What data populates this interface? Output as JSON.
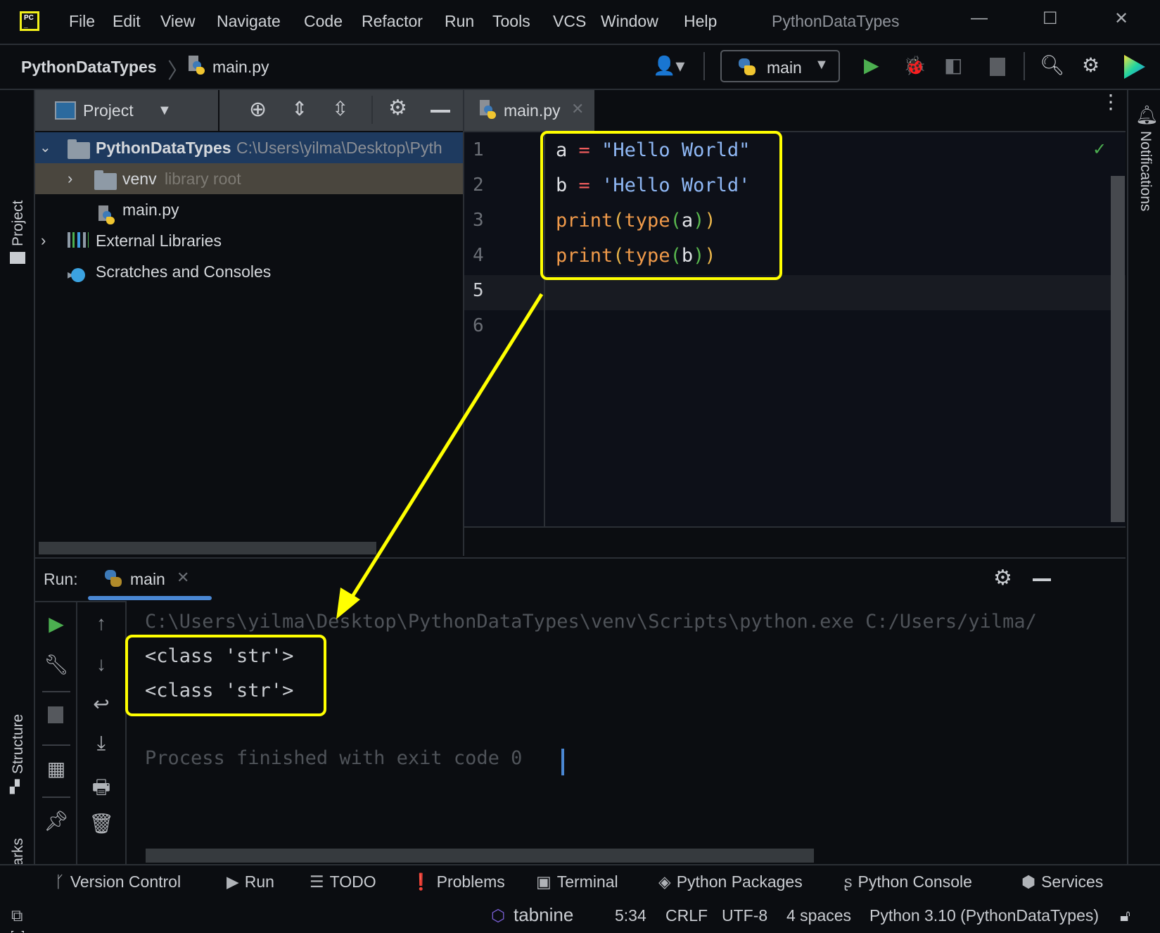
{
  "titlebar": {
    "menu": [
      "File",
      "Edit",
      "View",
      "Navigate",
      "Code",
      "Refactor",
      "Run",
      "Tools",
      "VCS",
      "Window",
      "Help"
    ],
    "window_title": "PythonDataTypes",
    "minimize": "—",
    "maximize": "☐",
    "close": "✕"
  },
  "navbar": {
    "project": "PythonDataTypes",
    "separator": "〉",
    "file": "main.py",
    "run_config": "main",
    "icons": [
      "user-icon",
      "run-icon",
      "debug-icon",
      "coverage-icon",
      "stop-icon",
      "search-icon",
      "settings-icon",
      "jetbrains-gateway-icon"
    ]
  },
  "left_stripe": {
    "project": "Project",
    "structure": "Structure",
    "bookmarks": "Bookmarks"
  },
  "project_panel": {
    "title": "Project",
    "tree": [
      {
        "label": "PythonDataTypes",
        "detail": "C:\\Users\\yilma\\Desktop\\Pyth",
        "expanded": true,
        "selected": true
      },
      {
        "label": "venv",
        "detail": "library root",
        "expanded": false
      },
      {
        "label": "main.py",
        "detail": ""
      },
      {
        "label": "External Libraries",
        "detail": "",
        "expanded": false
      },
      {
        "label": "Scratches and Consoles",
        "detail": ""
      }
    ]
  },
  "editor": {
    "tab": "main.py",
    "line_numbers": [
      "1",
      "2",
      "3",
      "4",
      "5",
      "6"
    ],
    "current_line": 5,
    "code": {
      "line1": {
        "a": "a",
        "eq": "=",
        "str": "\"Hello World\""
      },
      "line2": {
        "a": "b",
        "eq": "=",
        "str": "'Hello World'"
      },
      "line3": {
        "fn": "print",
        "p1": "(",
        "fn2": "type",
        "p2": "(",
        "arg": "a",
        "c2": ")",
        "c1": ")"
      },
      "line4": {
        "fn": "print",
        "p1": "(",
        "fn2": "type",
        "p2": "(",
        "arg": "b",
        "c2": ")",
        "c1": ")"
      }
    }
  },
  "right_stripe": {
    "notifications": "Notifications"
  },
  "run_panel": {
    "label": "Run:",
    "tab": "main",
    "console": {
      "command": "C:\\Users\\yilma\\Desktop\\PythonDataTypes\\venv\\Scripts\\python.exe C:/Users/yilma/",
      "output": [
        "<class 'str'>",
        "<class 'str'>"
      ],
      "exit": "Process finished with exit code 0"
    }
  },
  "bottom_tools": [
    "Version Control",
    "Run",
    "TODO",
    "Problems",
    "Terminal",
    "Python Packages",
    "Python Console",
    "Services"
  ],
  "statusbar": {
    "tabnine": "tabnine",
    "position": "5:34",
    "line_ending": "CRLF",
    "encoding": "UTF-8",
    "indent": "4 spaces",
    "interpreter": "Python 3.10 (PythonDataTypes)"
  },
  "colors": {
    "highlight": "#ffff00",
    "accent": "#4a87d3",
    "run_green": "#4caf50"
  }
}
